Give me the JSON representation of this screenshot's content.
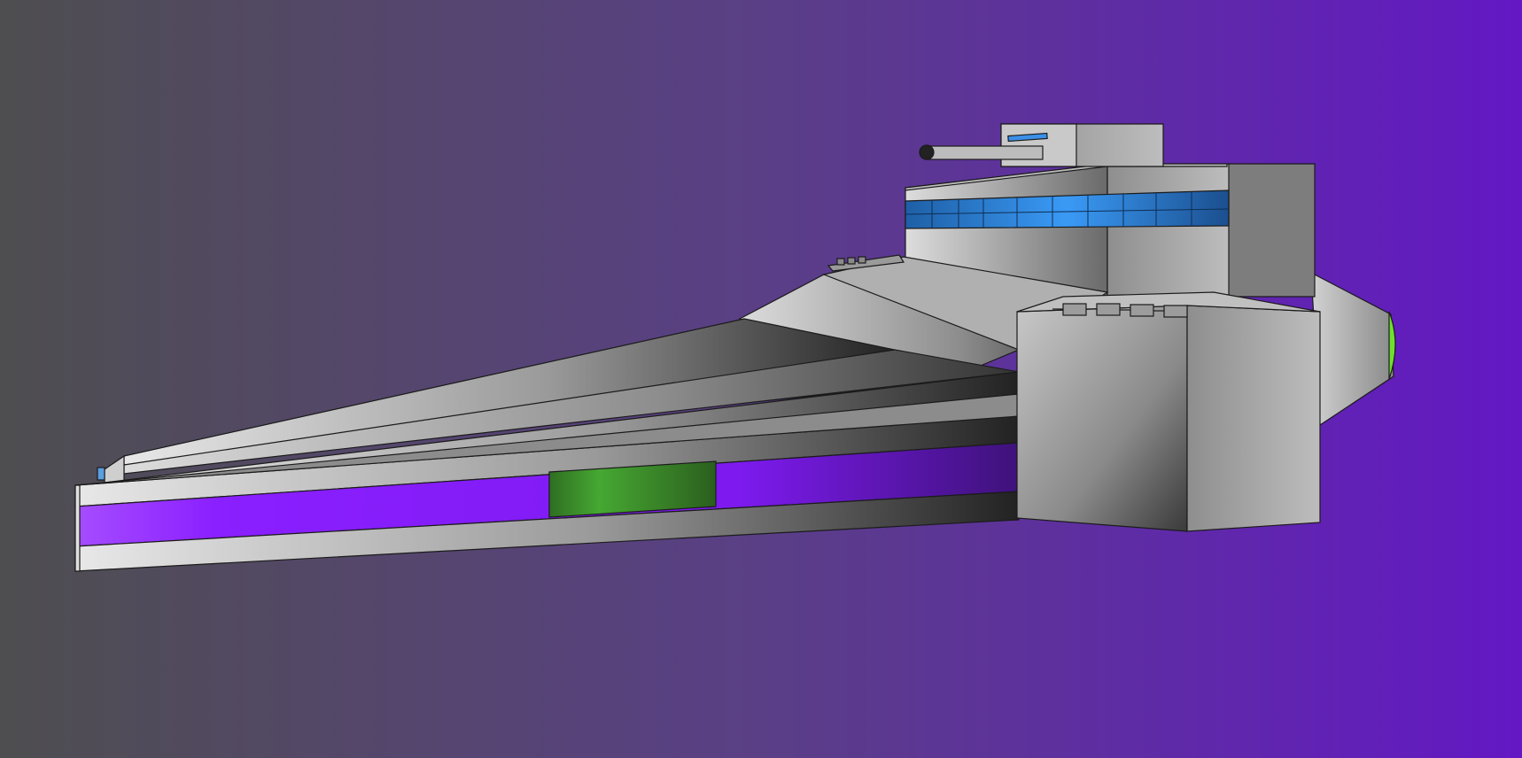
{
  "scene": {
    "subject": "spaceship-illustration",
    "colors": {
      "bg_left": "#4e4e50",
      "bg_mid": "#5a3f86",
      "bg_right": "#6318c4",
      "hull_light": "#d7d7d7",
      "hull_mid": "#a8a8a8",
      "hull_dark": "#2c2c2c",
      "purple_band": "#8a1fff",
      "green_panel": "#3e9a2c",
      "window_blue": "#2f8ff0",
      "engine_glow": "#6ee02e",
      "outline": "#1b1b1b"
    }
  }
}
